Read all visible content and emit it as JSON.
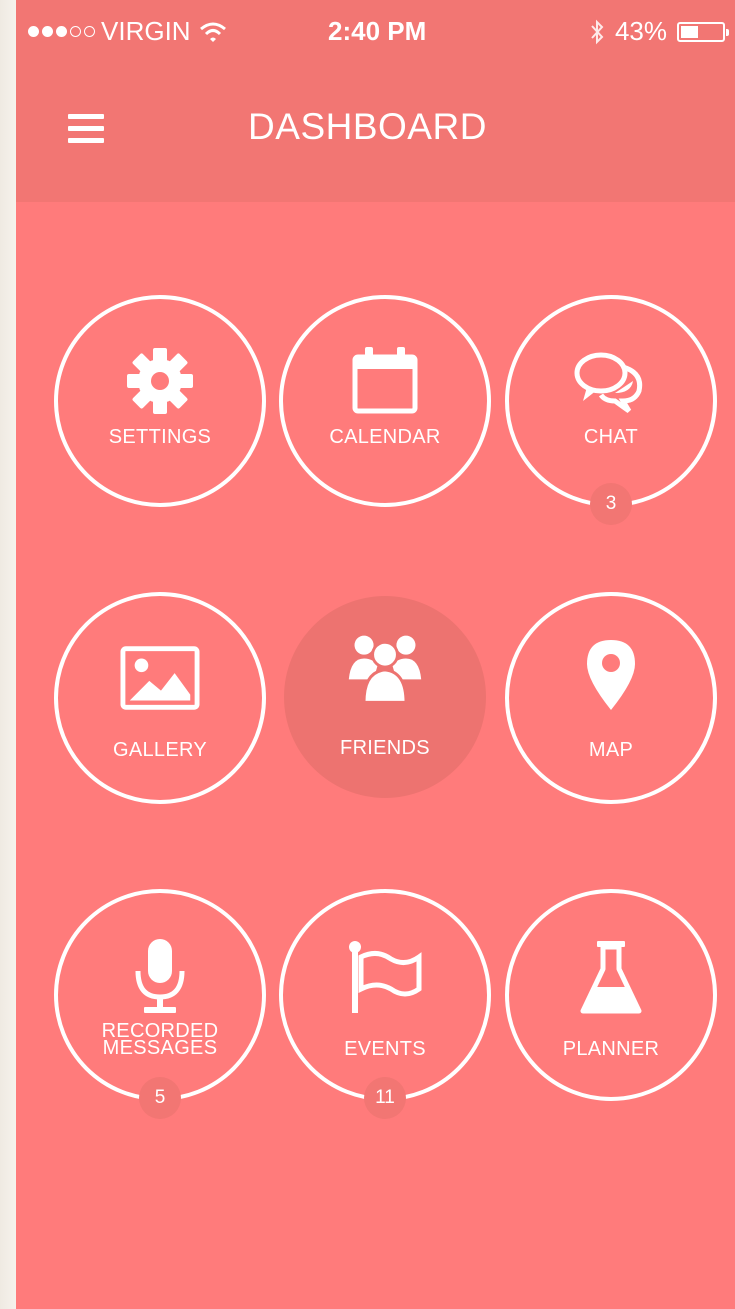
{
  "status_bar": {
    "carrier": "VIRGIN",
    "time": "2:40 PM",
    "battery": "43%",
    "battery_level": 0.43,
    "signal_bars": 3
  },
  "header": {
    "title": "DASHBOARD",
    "menu_icon": "hamburger-menu-icon"
  },
  "tiles": [
    {
      "label": "SETTINGS",
      "icon": "gear-icon"
    },
    {
      "label": "CALENDAR",
      "icon": "calendar-icon"
    },
    {
      "label": "CHAT",
      "icon": "chat-bubbles-icon",
      "badge": "3"
    },
    {
      "label": "GALLERY",
      "icon": "image-icon"
    },
    {
      "label": "FRIENDS",
      "icon": "group-icon",
      "active": true
    },
    {
      "label": "MAP",
      "icon": "map-pin-icon"
    },
    {
      "label_line1": "RECORDED",
      "label_line2": "MESSAGES",
      "icon": "microphone-icon",
      "badge": "5"
    },
    {
      "label": "EVENTS",
      "icon": "flag-icon",
      "badge": "11"
    },
    {
      "label": "PLANNER",
      "icon": "flask-icon"
    }
  ],
  "colors": {
    "background": "#ff7b7b",
    "header": "#f27673",
    "active_tile": "#ed7370",
    "foreground": "#ffffff"
  }
}
